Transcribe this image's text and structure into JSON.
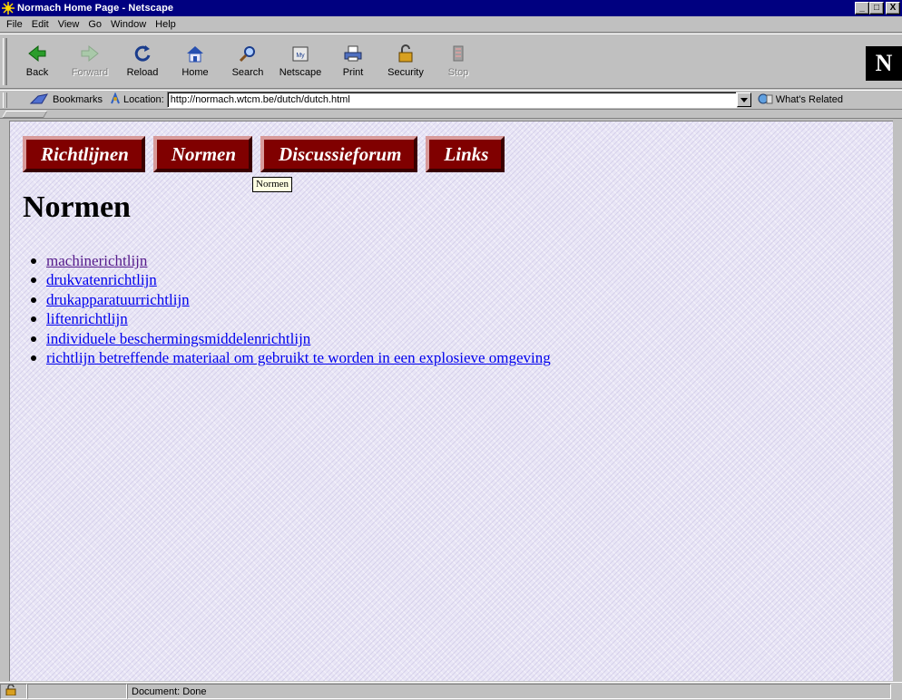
{
  "window": {
    "title": "Normach Home Page - Netscape",
    "controls": [
      "_",
      "□",
      "X"
    ]
  },
  "menu": [
    "File",
    "Edit",
    "View",
    "Go",
    "Window",
    "Help"
  ],
  "toolbar": {
    "buttons": [
      {
        "label": "Back",
        "icon": "back-arrow-icon",
        "enabled": true
      },
      {
        "label": "Forward",
        "icon": "forward-arrow-icon",
        "enabled": false
      },
      {
        "label": "Reload",
        "icon": "reload-icon",
        "enabled": true
      },
      {
        "label": "Home",
        "icon": "home-icon",
        "enabled": true
      },
      {
        "label": "Search",
        "icon": "search-icon",
        "enabled": true
      },
      {
        "label": "Netscape",
        "icon": "netscape-icon",
        "enabled": true
      },
      {
        "label": "Print",
        "icon": "print-icon",
        "enabled": true
      },
      {
        "label": "Security",
        "icon": "security-lock-icon",
        "enabled": true
      },
      {
        "label": "Stop",
        "icon": "stop-icon",
        "enabled": false
      }
    ],
    "logo_text": "N"
  },
  "location": {
    "bookmarks_label": "Bookmarks",
    "location_label": "Location:",
    "url": "http://normach.wtcm.be/dutch/dutch.html",
    "related_label": "What's Related"
  },
  "page": {
    "nav_buttons": [
      "Richtlijnen",
      "Normen",
      "Discussieforum",
      "Links"
    ],
    "tooltip": "Normen",
    "heading": "Normen",
    "links": [
      {
        "text": "machinerichtlijn",
        "visited": true
      },
      {
        "text": "drukvatenrichtlijn",
        "visited": false
      },
      {
        "text": "drukapparatuurrichtlijn",
        "visited": false
      },
      {
        "text": "liftenrichtlijn",
        "visited": false
      },
      {
        "text": "individuele beschermingsmiddelenrichtlijn",
        "visited": false
      },
      {
        "text": "richtlijn betreffende materiaal om gebruikt te worden in een explosieve omgeving",
        "visited": false
      }
    ],
    "colors": {
      "nav_button": "#800000",
      "link": "#0000ee",
      "visited_link": "#551a8b"
    }
  },
  "status": {
    "text": "Document: Done"
  }
}
